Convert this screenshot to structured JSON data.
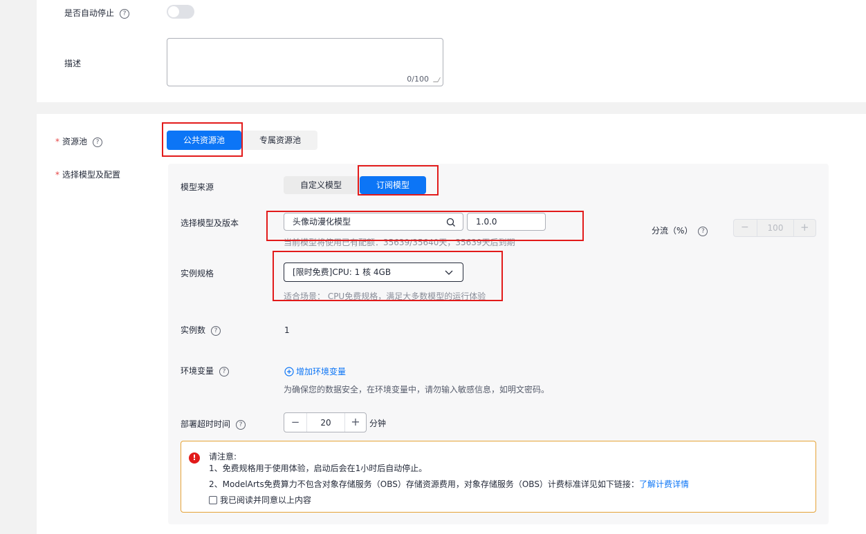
{
  "top": {
    "auto_stop_label": "是否自动停止",
    "description_label": "描述",
    "description_value": "",
    "description_count": "0/100"
  },
  "resource_pool": {
    "label": "资源池",
    "options": [
      "公共资源池",
      "专属资源池"
    ],
    "selected": "公共资源池"
  },
  "model_config": {
    "label": "选择模型及配置",
    "source_label": "模型来源",
    "source_options": [
      "自定义模型",
      "订阅模型"
    ],
    "source_selected": "订阅模型",
    "model_version_label": "选择模型及版本",
    "model_value": "头像动漫化模型",
    "version_value": "1.0.0",
    "model_hint": "当前模型将使用已有配额：35639/35640天，35639天后到期",
    "traffic_label": "分流（%）",
    "traffic_value": "100",
    "spec_label": "实例规格",
    "spec_value": "[限时免费]CPU: 1 核 4GB",
    "spec_hint": "适合场景： CPU免费规格，满足大多数模型的运行体验",
    "instances_label": "实例数",
    "instances_value": "1",
    "env_label": "环境变量",
    "env_add": "增加环境变量",
    "env_hint": "为确保您的数据安全，在环境变量中，请勿输入敏感信息，如明文密码。",
    "timeout_label": "部署超时时间",
    "timeout_value": "20",
    "timeout_unit": "分钟"
  },
  "notice": {
    "title": "请注意:",
    "line1": "1、免费规格用于使用体验，启动后会在1小时后自动停止。",
    "line2": "2、ModelArts免费算力不包含对象存储服务（OBS）存储资源费用，对象存储服务（OBS）计费标准详见如下链接：",
    "link": "了解计费详情",
    "agree": "我已阅读并同意以上内容"
  },
  "colors": {
    "primary": "#0c75f6",
    "highlight_box": "#e21a1a",
    "warning_border": "#e5a235",
    "error_icon": "#e21a1a"
  }
}
